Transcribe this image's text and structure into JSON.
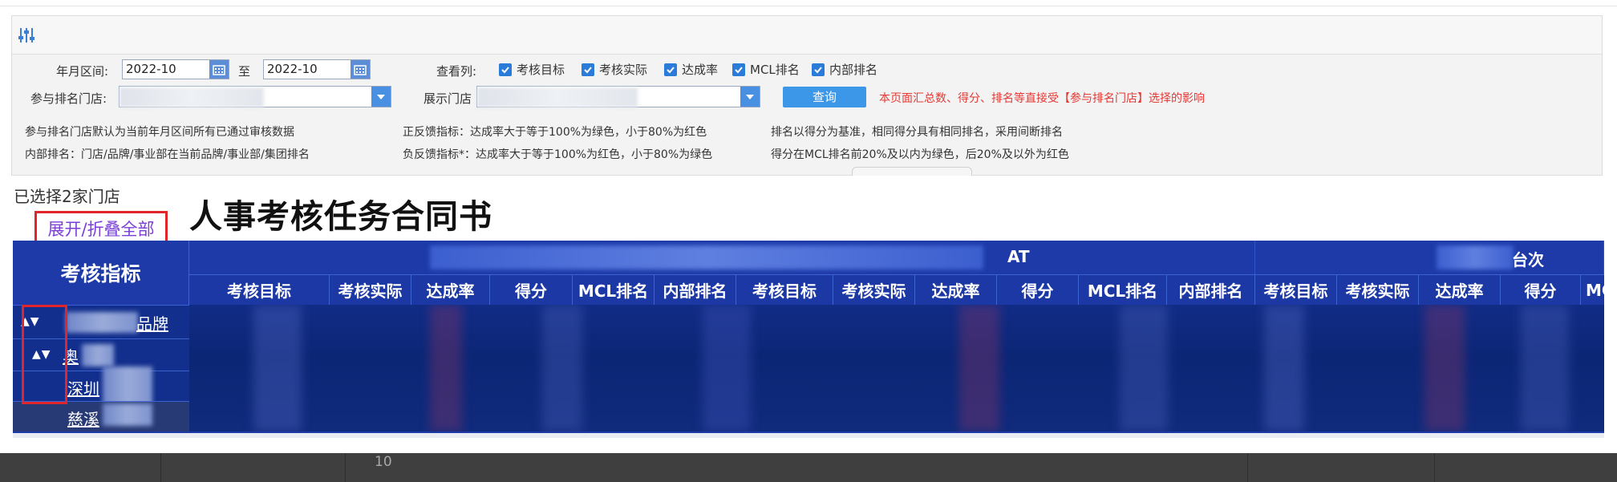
{
  "filters": {
    "period_label": "年月区间:",
    "date_from": "2022-10",
    "to_label": "至",
    "date_to": "2022-10",
    "participating_store_label": "参与排名门店:",
    "display_store_label": "展示门店",
    "view_columns_label": "查看列:",
    "columns": [
      {
        "label": "考核目标",
        "checked": true
      },
      {
        "label": "考核实际",
        "checked": true
      },
      {
        "label": "达成率",
        "checked": true
      },
      {
        "label": "MCL排名",
        "checked": true
      },
      {
        "label": "内部排名",
        "checked": true
      }
    ],
    "query_button": "查询",
    "warning": "本页面汇总数、得分、排名等直接受【参与排名门店】选择的影响"
  },
  "notes": {
    "n1": "参与排名门店默认为当前年月区间所有已通过审核数据",
    "n2": "正反馈指标：达成率大于等于100%为绿色，小于80%为红色",
    "n3": "排名以得分为基准，相同得分具有相同排名，采用间断排名",
    "n4": "内部排名：门店/品牌/事业部在当前品牌/事业部/集团排名",
    "n5": "负反馈指标*：达成率大于等于100%为红色，小于80%为绿色",
    "n6": "得分在MCL排名前20%及以内为绿色，后20%及以外为红色"
  },
  "selection": {
    "count_text": "已选择2家门店",
    "toggle_all": "展开/折叠全部"
  },
  "title": "人事考核任务合同书",
  "table": {
    "corner_header": "考核指标",
    "groups": [
      {
        "suffix": "AT"
      },
      {
        "suffix": "台次"
      }
    ],
    "column_headers": [
      "考核目标",
      "考核实际",
      "达成率",
      "得分",
      "MCL排名",
      "内部排名",
      "考核目标",
      "考核实际",
      "达成率",
      "得分",
      "MCL排名",
      "内部排名",
      "考核目标",
      "考核实际",
      "达成率",
      "得分",
      "MCI"
    ],
    "tree_rows": [
      {
        "arrows": "▲▼",
        "name": "品牌"
      },
      {
        "arrows": "▲▼",
        "name": "奥"
      },
      {
        "arrows": "",
        "name": "深圳"
      },
      {
        "arrows": "",
        "name": "慈溪"
      }
    ]
  },
  "footer": {
    "page_number": "10"
  },
  "colors": {
    "header_blue": "#1d3aa8",
    "body_navy": "#0f2470",
    "accent_blue": "#3d97e8",
    "warning_red": "#e53935",
    "highlight_red": "#e0262a",
    "link_purple": "#7a3fd9"
  }
}
